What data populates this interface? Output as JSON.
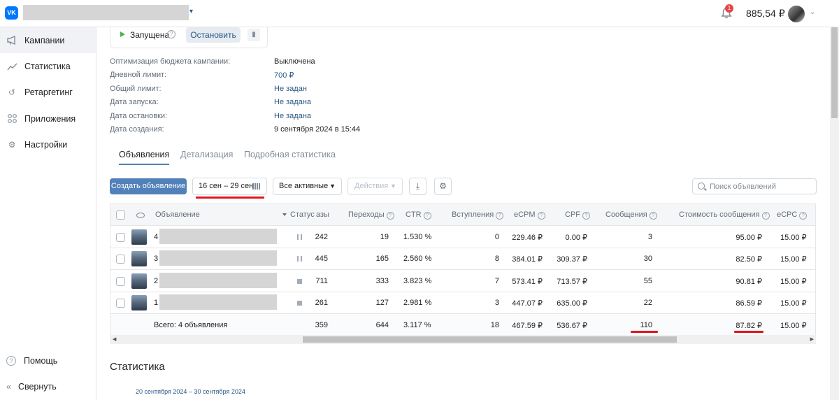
{
  "header": {
    "logo": "VK",
    "notifications_count": "1",
    "balance": "885,54 ₽"
  },
  "sidebar": {
    "items": [
      {
        "label": "Кампании",
        "icon": "megaphone-icon"
      },
      {
        "label": "Статистика",
        "icon": "chart-icon"
      },
      {
        "label": "Ретаргетинг",
        "icon": "retarget-icon"
      },
      {
        "label": "Приложения",
        "icon": "apps-icon"
      },
      {
        "label": "Настройки",
        "icon": "gear-icon"
      }
    ],
    "help_label": "Помощь",
    "collapse_label": "Свернуть"
  },
  "campaign": {
    "status_label": "Запущена",
    "stop_button": "Остановить",
    "info": [
      {
        "label": "Оптимизация бюджета кампании:",
        "value": "Выключена"
      },
      {
        "label": "Дневной лимит:",
        "value": "700 ₽"
      },
      {
        "label": "Общий лимит:",
        "value": "Не задан"
      },
      {
        "label": "Дата запуска:",
        "value": "Не задана"
      },
      {
        "label": "Дата остановки:",
        "value": "Не задана"
      },
      {
        "label": "Дата создания:",
        "value": "9 сентября 2024 в 15:44"
      }
    ]
  },
  "tabs": [
    "Объявления",
    "Детализация",
    "Подробная статистика"
  ],
  "toolbar": {
    "create_button": "Создать объявление",
    "date_range": "16 сен – 29 сен",
    "filter": "Все активные",
    "actions": "Действия",
    "search_placeholder": "Поиск объявлений"
  },
  "table": {
    "headers": {
      "ad": "Объявление",
      "status": "Статус",
      "impressions": "азы",
      "clicks": "Переходы",
      "ctr": "CTR",
      "joins": "Вступления",
      "ecpm": "eCPM",
      "cpf": "CPF",
      "messages": "Сообщения",
      "msg_cost": "Стоимость сообщения",
      "ecpc": "eCPC"
    },
    "rows": [
      {
        "num": "4",
        "status": "paused",
        "impressions": "242",
        "clicks": "19",
        "ctr": "1.530 %",
        "joins": "0",
        "ecpm": "229.46 ₽",
        "cpf": "0.00 ₽",
        "messages": "3",
        "msg_cost": "95.00 ₽",
        "ecpc": "15.00 ₽"
      },
      {
        "num": "3",
        "status": "paused",
        "impressions": "445",
        "clicks": "165",
        "ctr": "2.560 %",
        "joins": "8",
        "ecpm": "384.01 ₽",
        "cpf": "309.37 ₽",
        "messages": "30",
        "msg_cost": "82.50 ₽",
        "ecpc": "15.00 ₽"
      },
      {
        "num": "2",
        "status": "stopped",
        "impressions": "711",
        "clicks": "333",
        "ctr": "3.823 %",
        "joins": "7",
        "ecpm": "573.41 ₽",
        "cpf": "713.57 ₽",
        "messages": "55",
        "msg_cost": "90.81 ₽",
        "ecpc": "15.00 ₽"
      },
      {
        "num": "1",
        "status": "stopped",
        "impressions": "261",
        "clicks": "127",
        "ctr": "2.981 %",
        "joins": "3",
        "ecpm": "447.07 ₽",
        "cpf": "635.00 ₽",
        "messages": "22",
        "msg_cost": "86.59 ₽",
        "ecpc": "15.00 ₽"
      }
    ],
    "total": {
      "label": "Всего: 4 объявления",
      "impressions": "359",
      "clicks": "644",
      "ctr": "3.117 %",
      "joins": "18",
      "ecpm": "467.59 ₽",
      "cpf": "536.67 ₽",
      "messages": "110",
      "msg_cost": "87.82 ₽",
      "ecpc": "15.00 ₽"
    }
  },
  "stats": {
    "title": "Статистика",
    "period": "20 сентября 2024 – 30 сентября 2024"
  },
  "colors": {
    "accent": "#5181b8",
    "link": "#2a5885",
    "highlight": "#e0161d"
  }
}
